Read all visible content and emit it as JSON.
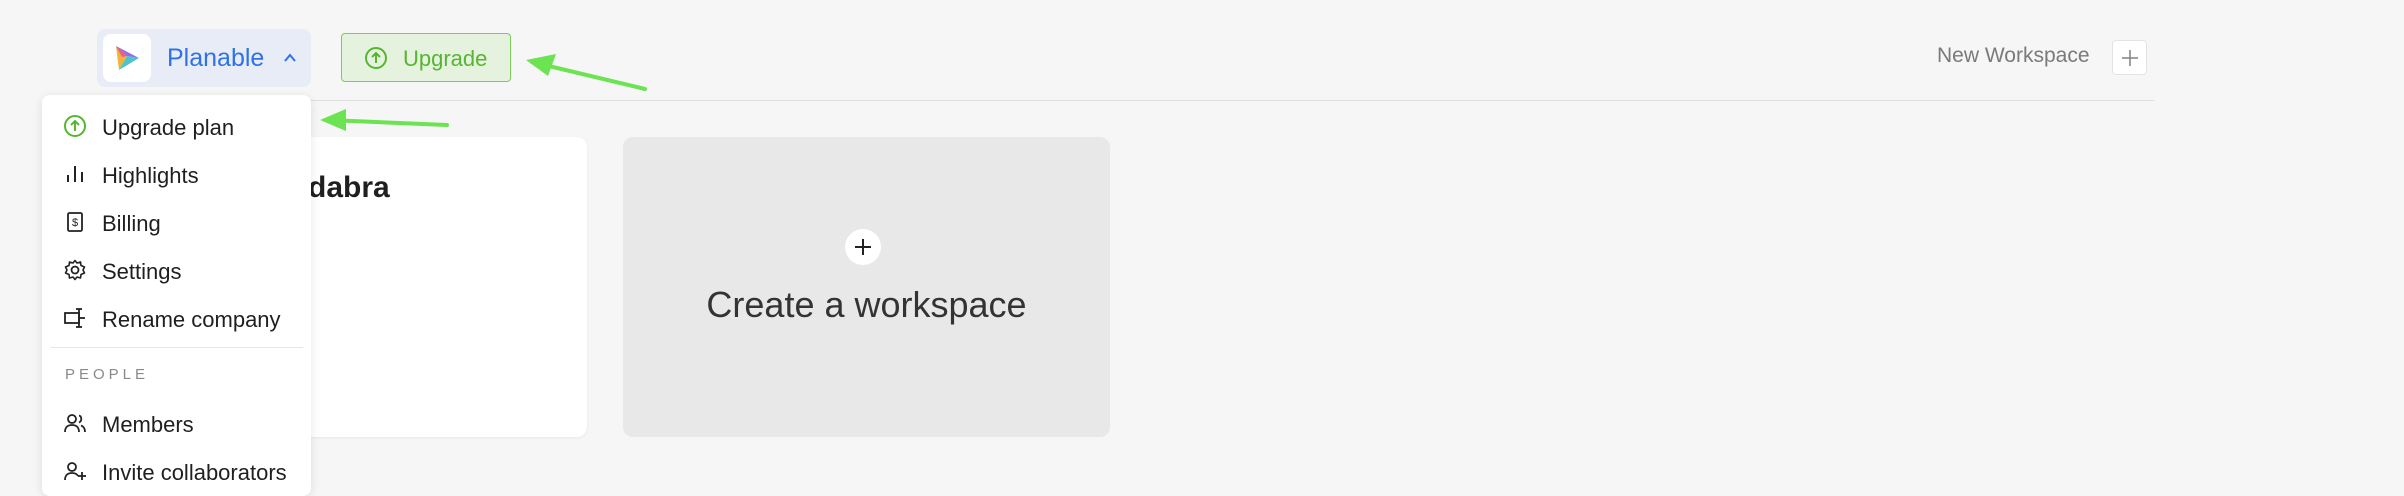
{
  "header": {
    "company_name": "Planable",
    "upgrade_label": "Upgrade",
    "new_workspace_label": "New Workspace"
  },
  "workspace_card": {
    "title": "dabra"
  },
  "create_card": {
    "title": "Create a workspace"
  },
  "menu": {
    "items": [
      {
        "label": "Upgrade plan",
        "icon": "upgrade-icon"
      },
      {
        "label": "Highlights",
        "icon": "bar-chart-icon"
      },
      {
        "label": "Billing",
        "icon": "receipt-icon"
      },
      {
        "label": "Settings",
        "icon": "gear-icon"
      },
      {
        "label": "Rename company",
        "icon": "rename-icon"
      }
    ],
    "section_label": "PEOPLE",
    "people_items": [
      {
        "label": "Members",
        "icon": "users-icon"
      },
      {
        "label": "Invite collaborators",
        "icon": "user-plus-icon"
      }
    ]
  },
  "colors": {
    "brand_blue": "#2f72e8",
    "upgrade_green": "#56b634",
    "arrow_green": "#6be352"
  }
}
